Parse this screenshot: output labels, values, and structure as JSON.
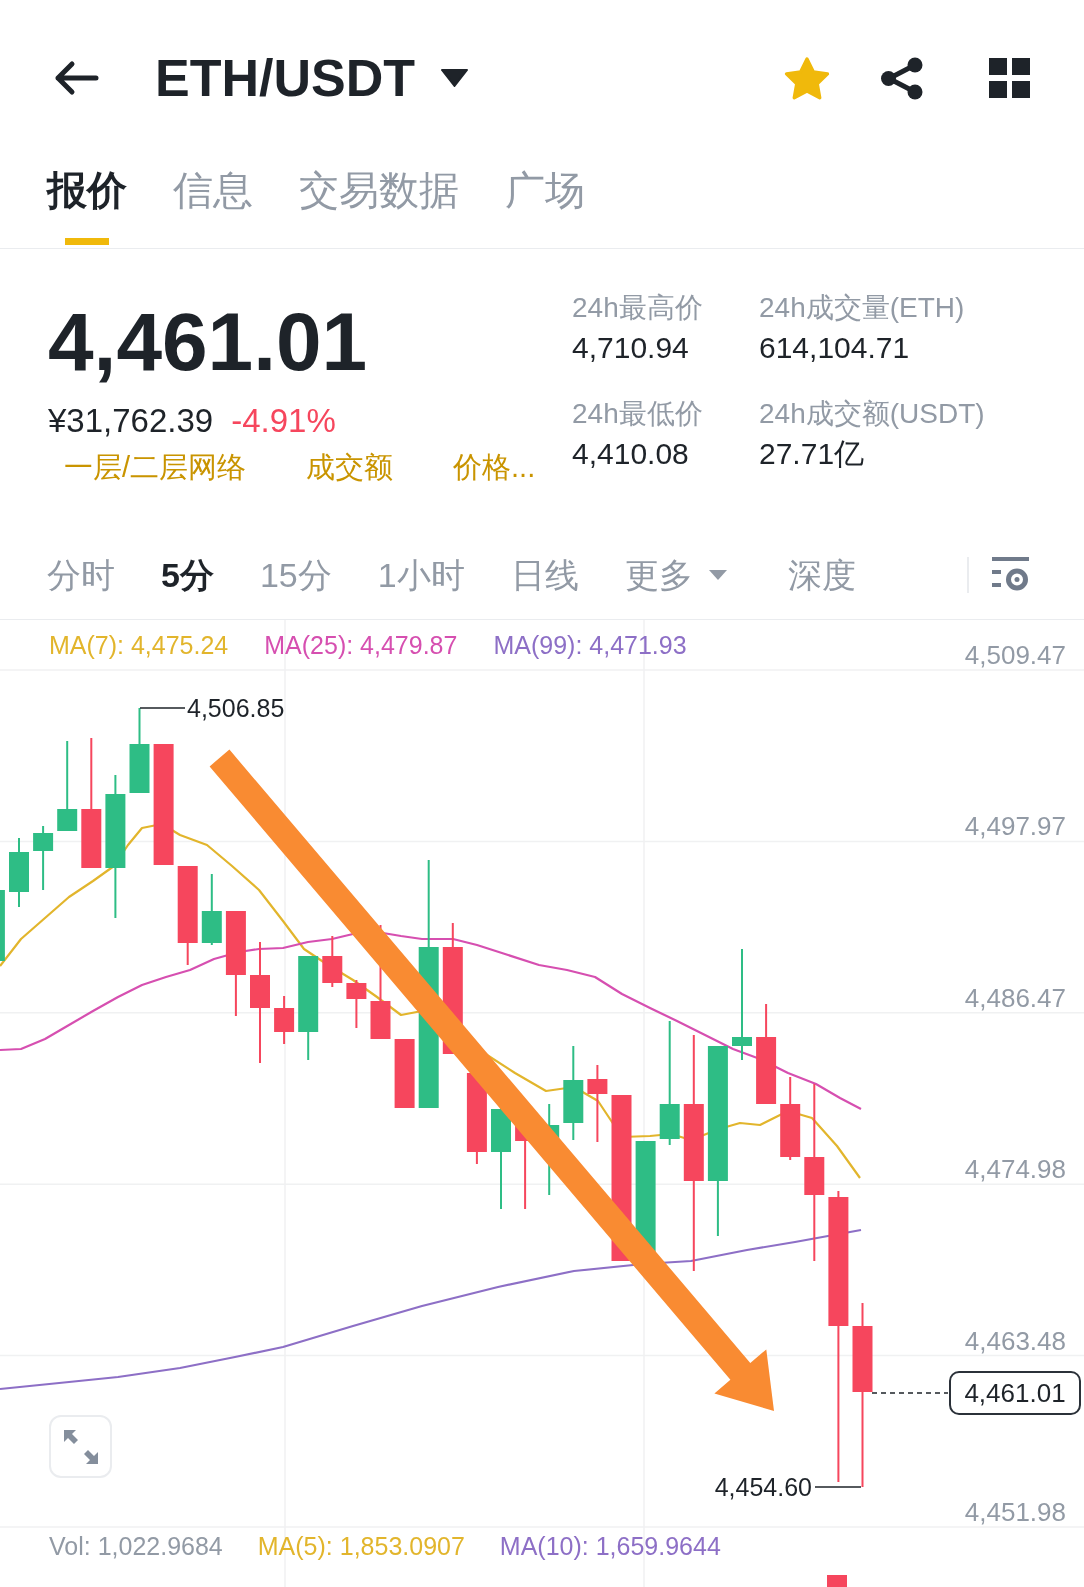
{
  "header": {
    "title": "ETH/USDT",
    "favorite": true
  },
  "tabs": [
    {
      "label": "报价",
      "selected": true
    },
    {
      "label": "信息",
      "selected": false
    },
    {
      "label": "交易数据",
      "selected": false
    },
    {
      "label": "广场",
      "selected": false
    }
  ],
  "ticker": {
    "price": "4,461.01",
    "fiat_price": "¥31,762.39",
    "change": "-4.91%",
    "links": [
      "一层/二层网络",
      "成交额",
      "价格..."
    ],
    "stats": [
      {
        "label": "24h最高价",
        "value": "4,710.94"
      },
      {
        "label": "24h成交量(ETH)",
        "value": "614,104.71"
      },
      {
        "label": "24h最低价",
        "value": "4,410.08"
      },
      {
        "label": "24h成交额(USDT)",
        "value": "27.71亿"
      }
    ]
  },
  "intervals": [
    {
      "label": "分时",
      "kind": "interval",
      "selected": false
    },
    {
      "label": "5分",
      "kind": "interval",
      "selected": true
    },
    {
      "label": "15分",
      "kind": "interval",
      "selected": false
    },
    {
      "label": "1小时",
      "kind": "interval",
      "selected": false
    },
    {
      "label": "日线",
      "kind": "interval",
      "selected": false
    },
    {
      "label": "更多",
      "kind": "dropdown",
      "selected": false
    },
    {
      "label": "深度",
      "kind": "view",
      "selected": false
    }
  ],
  "chart": {
    "ma_legend": [
      {
        "label": "MA(7): 4,475.24",
        "color": "#e2b52c"
      },
      {
        "label": "MA(25): 4,479.87",
        "color": "#d64fb0"
      },
      {
        "label": "MA(99): 4,471.93",
        "color": "#8d6fc6"
      }
    ],
    "price_axis": [
      "4,509.47",
      "4,497.97",
      "4,486.47",
      "4,474.98",
      "4,463.48",
      "4,451.98"
    ],
    "high_label": "4,506.85",
    "low_label": "4,454.60",
    "last_price": "4,461.01",
    "volume_legend": [
      {
        "label": "Vol: 1,022.9684",
        "color": "#929aa5"
      },
      {
        "label": "MA(5): 1,853.0907",
        "color": "#e2b52c"
      },
      {
        "label": "MA(10): 1,659.9644",
        "color": "#8d6fc6"
      }
    ]
  }
}
